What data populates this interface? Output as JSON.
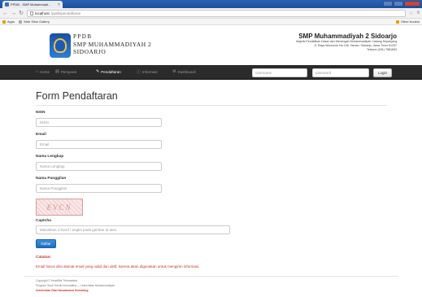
{
  "browser": {
    "tab_title": "PPDB - SMP Muhammadi...",
    "tab_close": "×",
    "url_host": "localhost",
    "url_path": "/ppdb/pendaftaran",
    "bookmarks": [
      "Apps",
      "Web Slice Gallery"
    ],
    "other_bookmarks": "Other bookm"
  },
  "header": {
    "ppdb": "PPDB",
    "school_line1": "SMP MUHAMMADIYAH 2",
    "school_line2": "SIDOARJO",
    "school_name": "SMP Muhammadiyah 2 Sidoarjo",
    "address_line1": "Majelis Pendidikan Dasar dan Menengah Muhammadiyah Cabang Sepanjang",
    "address_line2": "Jl. Raya Wonocolo No.136, Taman, Sidoarjo, Jawa Timur 61257",
    "phone": "Telepon (031) 7881653"
  },
  "navbar": {
    "items": [
      "Home",
      "Persyarat",
      "Pendaftaran",
      "Informasi",
      "Dashboard"
    ],
    "icons": [
      "home-icon",
      "calendar-icon",
      "pencil-icon",
      "info-icon",
      "dashboard-icon"
    ],
    "username_placeholder": "username",
    "password_placeholder": "password",
    "login_label": "Login"
  },
  "form": {
    "title": "Form Pendaftaran",
    "nisn_label": "NISN",
    "nisn_placeholder": "NISN",
    "email_label": "Email",
    "email_placeholder": "Email",
    "nama_label": "Nama Lengkap",
    "nama_placeholder": "Nama Lengkap",
    "panggilan_label": "Nama Panggilan",
    "panggilan_placeholder": "Nama Panggilan",
    "captcha_text": "EVCN",
    "captcha_label": "Captcha",
    "captcha_placeholder": "Masukkan 4 huruf / angka pada gambar di atas.",
    "submit_label": "Daftar",
    "note_title": "Catatan:",
    "note_text": "Email harus diisi alamat email yang valid dan aktif, karena akan digunakan untuk mengirim informasi."
  },
  "footer": {
    "line1": "Copyright © Heartfilia Thierrastela",
    "line2": "Program Studi Teknik Informatika — Universitas Muhammadiyah",
    "line3": "Universitas Dian Nuswantoro Semarang"
  }
}
